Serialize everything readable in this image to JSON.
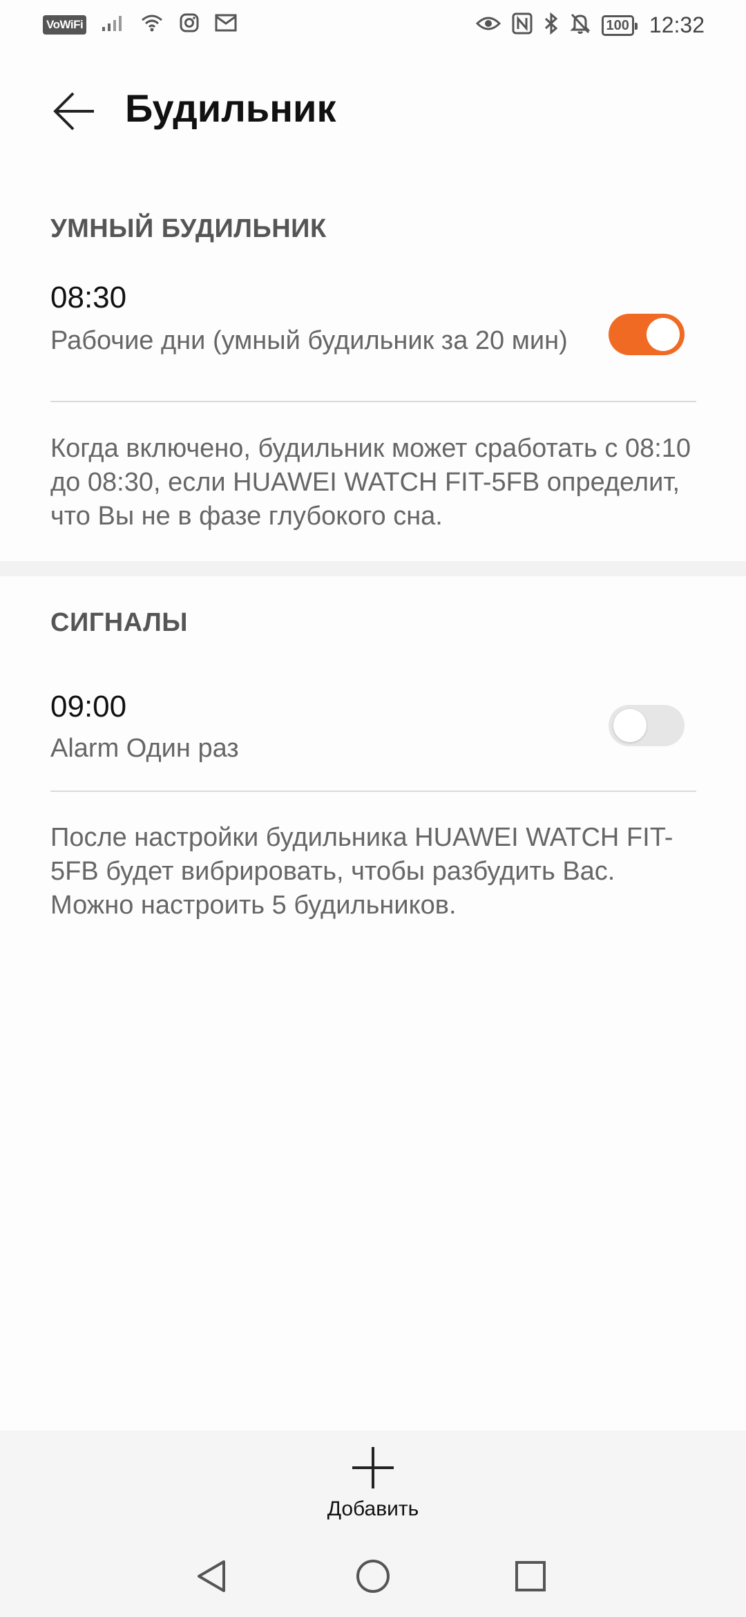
{
  "status_bar": {
    "vowifi": "VoWiFi",
    "battery": "100",
    "time": "12:32",
    "icons_left": [
      "vowifi-icon",
      "signal-icon",
      "wifi-icon",
      "instagram-icon",
      "mail-icon"
    ],
    "icons_right": [
      "eye-icon",
      "nfc-icon",
      "bluetooth-icon",
      "bell-off-icon",
      "battery-icon"
    ]
  },
  "header": {
    "title": "Будильник"
  },
  "smart_alarm": {
    "section_title": "УМНЫЙ БУДИЛЬНИК",
    "time": "08:30",
    "description": "Рабочие дни (умный будильник за 20 мин)",
    "enabled": true,
    "note": "Когда включено, будильник может сработать с 08:10 до 08:30, если HUAWEI WATCH FIT-5FB определит, что Вы не в фазе глубокого сна."
  },
  "signals": {
    "section_title": "СИГНАЛЫ",
    "time": "09:00",
    "description": "Alarm Один раз",
    "enabled": false,
    "note": "После настройки будильника HUAWEI WATCH FIT-5FB будет вибрировать, чтобы разбудить Вас. Можно настроить 5 будильников."
  },
  "actions": {
    "add_label": "Добавить"
  },
  "colors": {
    "accent": "#f06a24",
    "toggle_off": "#e6e6e6"
  }
}
